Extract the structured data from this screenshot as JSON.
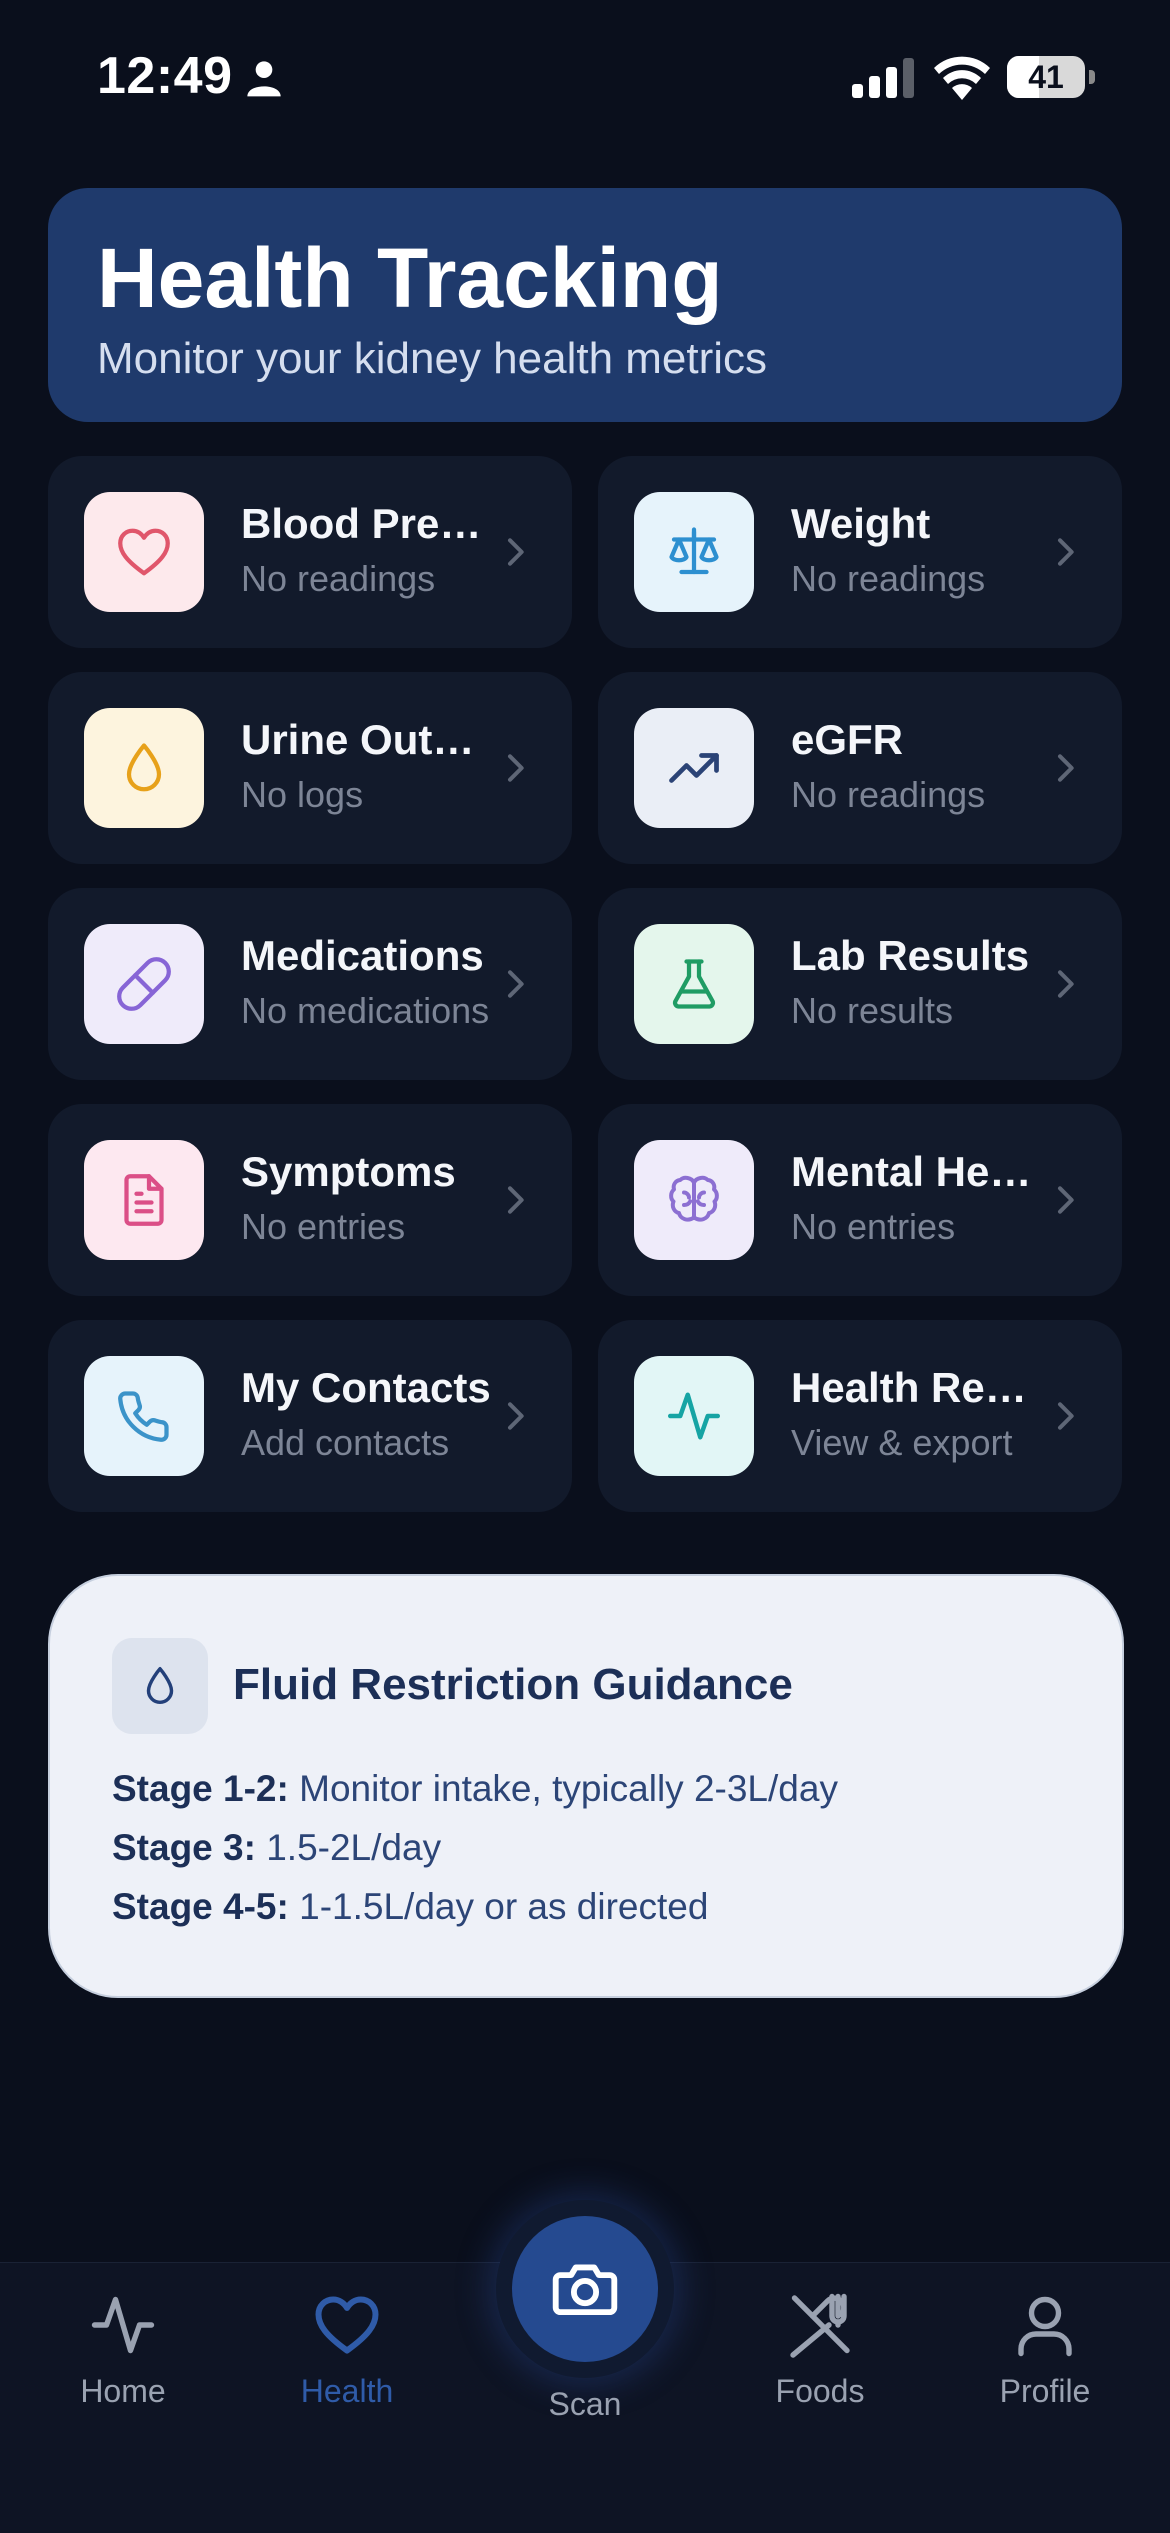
{
  "status_bar": {
    "time": "12:49",
    "battery": "41",
    "battery_level": 0.41
  },
  "header": {
    "title": "Health Tracking",
    "subtitle": "Monitor your kidney health metrics"
  },
  "tiles": [
    {
      "id": "blood-pressure",
      "title": "Blood Pressure",
      "subtitle": "No readings",
      "icon": "heart-icon",
      "bg": "#fde9ec",
      "fg": "#e0566b"
    },
    {
      "id": "weight",
      "title": "Weight",
      "subtitle": "No readings",
      "icon": "scale-icon",
      "bg": "#e6f3fb",
      "fg": "#2d8fd0"
    },
    {
      "id": "urine-output",
      "title": "Urine Output",
      "subtitle": "No logs",
      "icon": "droplet-icon",
      "bg": "#fdf4de",
      "fg": "#e7a11a"
    },
    {
      "id": "egfr",
      "title": "eGFR",
      "subtitle": "No readings",
      "icon": "trending-up-icon",
      "bg": "#eaeef6",
      "fg": "#2b4376"
    },
    {
      "id": "medications",
      "title": "Medications",
      "subtitle": "No medications",
      "icon": "pill-icon",
      "bg": "#efebfa",
      "fg": "#8765d6"
    },
    {
      "id": "lab-results",
      "title": "Lab Results",
      "subtitle": "No results",
      "icon": "flask-icon",
      "bg": "#e4f6ec",
      "fg": "#1f9c64"
    },
    {
      "id": "symptoms",
      "title": "Symptoms",
      "subtitle": "No entries",
      "icon": "document-icon",
      "bg": "#fde8f0",
      "fg": "#db4f87"
    },
    {
      "id": "mental-health",
      "title": "Mental Health",
      "subtitle": "No entries",
      "icon": "brain-icon",
      "bg": "#efebfa",
      "fg": "#8c6fd2"
    },
    {
      "id": "my-contacts",
      "title": "My Contacts",
      "subtitle": "Add contacts",
      "icon": "phone-icon",
      "bg": "#e6f3fb",
      "fg": "#3b93c9"
    },
    {
      "id": "health-report",
      "title": "Health Report",
      "subtitle": "View & export",
      "icon": "activity-icon",
      "bg": "#e2f6f6",
      "fg": "#16a4a4"
    }
  ],
  "fluid_guidance": {
    "title": "Fluid Restriction Guidance",
    "lines": [
      {
        "label": "Stage 1-2:",
        "text": "Monitor intake, typically 2-3L/day"
      },
      {
        "label": "Stage 3:",
        "text": "1.5-2L/day"
      },
      {
        "label": "Stage 4-5:",
        "text": "1-1.5L/day or as directed"
      }
    ]
  },
  "nav": {
    "home": "Home",
    "health": "Health",
    "scan": "Scan",
    "foods": "Foods",
    "profile": "Profile",
    "active": "health"
  },
  "colors": {
    "background": "#0a0f1c",
    "header": "#1f3a6c",
    "tile": "#121a2b",
    "accent": "#2f5ba8"
  }
}
